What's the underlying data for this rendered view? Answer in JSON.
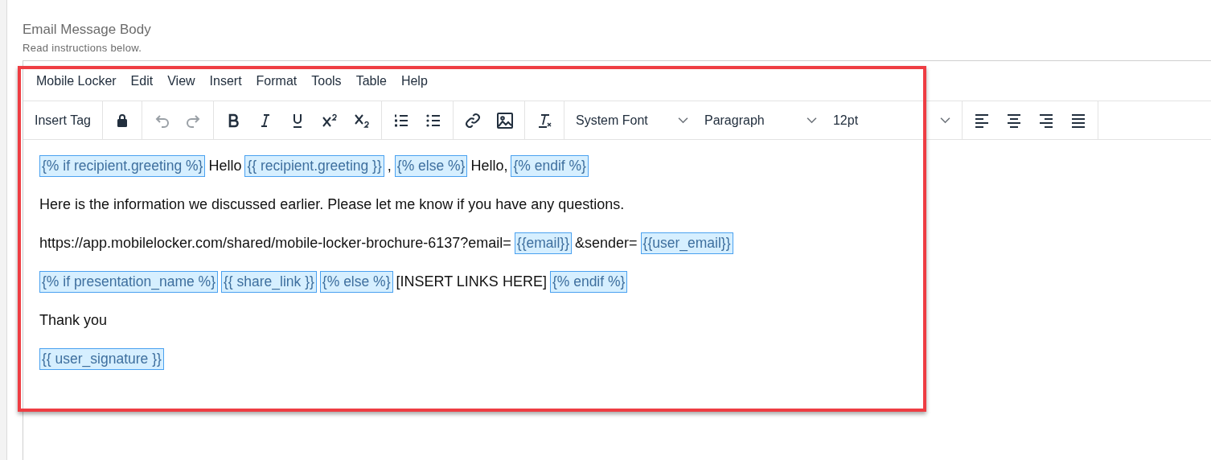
{
  "field": {
    "label": "Email Message Body",
    "hint": "Read instructions below."
  },
  "menubar": [
    "Mobile Locker",
    "Edit",
    "View",
    "Insert",
    "Format",
    "Tools",
    "Table",
    "Help"
  ],
  "toolbar": [
    [
      {
        "kind": "text",
        "label": "Insert Tag"
      }
    ],
    [
      {
        "kind": "lock",
        "disabled": false
      }
    ],
    [
      {
        "kind": "undo",
        "disabled": true
      },
      {
        "kind": "redo",
        "disabled": true
      }
    ],
    [
      {
        "kind": "bold",
        "disabled": false
      },
      {
        "kind": "italic",
        "disabled": false
      },
      {
        "kind": "underline",
        "disabled": false
      },
      {
        "kind": "superscript",
        "disabled": false
      },
      {
        "kind": "subscript",
        "disabled": false
      }
    ],
    [
      {
        "kind": "numbered-list",
        "disabled": false
      },
      {
        "kind": "bullet-list",
        "disabled": false
      }
    ],
    [
      {
        "kind": "link",
        "disabled": false
      },
      {
        "kind": "image",
        "disabled": false
      }
    ],
    [
      {
        "kind": "clear-format",
        "disabled": false
      }
    ],
    [
      {
        "kind": "dropdown",
        "label": "System Font"
      },
      {
        "kind": "dropdown",
        "label": "Paragraph"
      },
      {
        "kind": "dropdown-wide",
        "label": "12pt"
      }
    ],
    [
      {
        "kind": "align-left",
        "disabled": false
      },
      {
        "kind": "align-center",
        "disabled": false
      },
      {
        "kind": "align-right",
        "disabled": false
      },
      {
        "kind": "justify",
        "disabled": false
      }
    ]
  ],
  "paragraphs": [
    [
      {
        "kind": "tag",
        "text": "{% if recipient.greeting %}"
      },
      {
        "kind": "text",
        "text": "Hello"
      },
      {
        "kind": "tag",
        "text": "{{ recipient.greeting }}"
      },
      {
        "kind": "text",
        "text": ","
      },
      {
        "kind": "tag",
        "text": "{% else %}"
      },
      {
        "kind": "text",
        "text": "Hello,"
      },
      {
        "kind": "tag",
        "text": "{% endif %}"
      }
    ],
    [
      {
        "kind": "text",
        "text": "Here is the information we discussed earlier. Please let me know if you have any questions."
      }
    ],
    [
      {
        "kind": "text",
        "text": "https://app.mobilelocker.com/shared/mobile-locker-brochure-6137?email="
      },
      {
        "kind": "tag",
        "text": "{{email}}"
      },
      {
        "kind": "text",
        "text": "&sender="
      },
      {
        "kind": "tag",
        "text": "{{user_email}}"
      }
    ],
    [
      {
        "kind": "tag",
        "text": "{% if presentation_name %}"
      },
      {
        "kind": "tag",
        "text": "{{ share_link }}"
      },
      {
        "kind": "tag",
        "text": "{% else %}"
      },
      {
        "kind": "text",
        "text": "[INSERT LINKS HERE]"
      },
      {
        "kind": "tag",
        "text": "{% endif %}"
      }
    ],
    [
      {
        "kind": "text",
        "text": "Thank you"
      }
    ],
    [
      {
        "kind": "tag",
        "text": "{{ user_signature }}"
      }
    ]
  ]
}
